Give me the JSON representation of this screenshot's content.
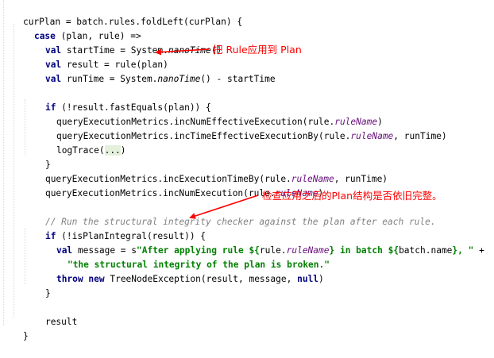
{
  "code": {
    "l1": [
      "curPlan = batch.rules.foldLeft(curPlan) {"
    ],
    "l2": [
      "case",
      " (plan, rule) =>"
    ],
    "l3": [
      "val",
      " startTime = System.",
      "nanoTime",
      "()"
    ],
    "l4": [
      "val",
      " result = rule(plan)"
    ],
    "l5": [
      "val",
      " runTime = System.",
      "nanoTime",
      "() - startTime"
    ],
    "l7": [
      "if",
      " (!result.fastEquals(plan)) {"
    ],
    "l8": [
      "queryExecutionMetrics.incNumEffectiveExecution(rule.",
      "ruleName",
      ")"
    ],
    "l9": [
      "queryExecutionMetrics.incTimeEffectiveExecutionBy(rule.",
      "ruleName",
      ", runTime)"
    ],
    "l10": [
      "logTrace(",
      "...",
      ")"
    ],
    "l11": [
      "}"
    ],
    "l12": [
      "queryExecutionMetrics.incExecutionTimeBy(rule.",
      "ruleName",
      ", runTime)"
    ],
    "l13": [
      "queryExecutionMetrics.incNumExecution(rule.",
      "ruleName",
      ")"
    ],
    "l15": [
      "// Run the structural integrity checker against the plan after each rule."
    ],
    "l16": [
      "if",
      " (!isPlanIntegral(result)) {"
    ],
    "l17": [
      "val",
      " message = s",
      "\"After applying rule ${",
      "rule.",
      "ruleName",
      "} in batch ${",
      "batch.name",
      "}, \"",
      " +"
    ],
    "l18": [
      "\"the structural integrity of the plan is broken.\""
    ],
    "l19": [
      "throw",
      " ",
      "new",
      " TreeNodeException(result, message, ",
      "null",
      ")"
    ],
    "l20": [
      "}"
    ],
    "l22": [
      "result"
    ],
    "l23": [
      "}"
    ]
  },
  "annotations": {
    "apply_rule": "把 Rule应用到 Plan",
    "integrity_check": "检查应用之后的Plan结构是否依旧完整。"
  },
  "colors": {
    "keyword": "#000080",
    "field": "#660e7a",
    "string": "#008000",
    "comment": "#808080",
    "annotation": "#ff0000",
    "folded_highlight": "#e4f0dc"
  }
}
